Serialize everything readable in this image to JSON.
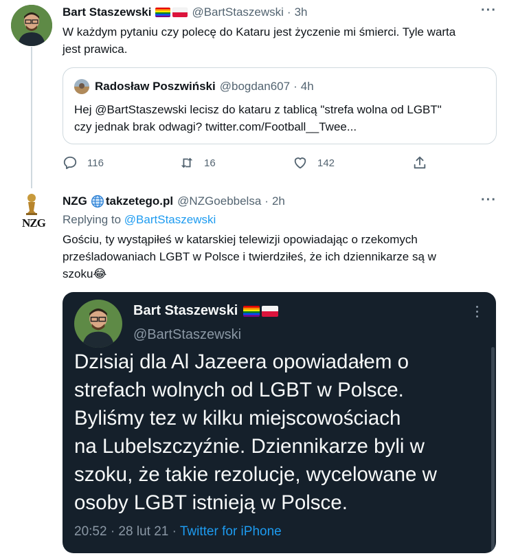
{
  "tweet1": {
    "author_name": "Bart Staszewski",
    "author_handle": "@BartStaszewski",
    "time": "3h",
    "text_line1": "W każdym pytaniu czy polecę do Kataru jest życzenie mi śmierci. Tyle warta",
    "text_line2": "jest prawica.",
    "quote": {
      "author_name": "Radosław Poszwiński",
      "author_handle": "@bogdan607",
      "time": "4h",
      "text_line1": "Hej @BartStaszewski lecisz do kataru z tablicą \"strefa wolna od LGBT\"",
      "text_line2": "czy jednak brak odwagi? twitter.com/Football__Twee..."
    },
    "actions": {
      "replies": "116",
      "retweets": "16",
      "likes": "142"
    }
  },
  "tweet2": {
    "author_name": "NZG",
    "author_name_link": "takzetego.pl",
    "author_handle": "@NZGoebbelsa",
    "time": "2h",
    "replying_label": "Replying to",
    "replying_handle": "@BartStaszewski",
    "text_line1": "Gościu, ty wystąpiłeś w katarskiej telewizji opowiadając o rzekomych",
    "text_line2": "prześladowaniach LGBT w Polsce i twierdziłeś, że ich dziennikarze są w",
    "text_line3": "szoku",
    "emoji": "😂",
    "avatar_text": "NZG",
    "screenshot": {
      "author_name": "Bart Staszewski",
      "author_handle": "@BartStaszewski",
      "lines": [
        "Dzisiaj dla Al Jazeera opowiadałem o",
        "strefach wolnych od LGBT w Polsce.",
        "Byliśmy tez w kilku miejscowościach",
        "na Lubelszczyźnie. Dziennikarze byli w",
        "szoku, że takie rezolucje, wycelowane w",
        "osoby LGBT istnieją w Polsce."
      ],
      "time_date": "20:52 · 28 lut 21 ·",
      "source": "Twitter for iPhone"
    }
  },
  "more_icon": "more-dots-icon",
  "colors": {
    "link": "#1d9bf0",
    "muted": "#536471",
    "dark_card": "#15202b"
  }
}
